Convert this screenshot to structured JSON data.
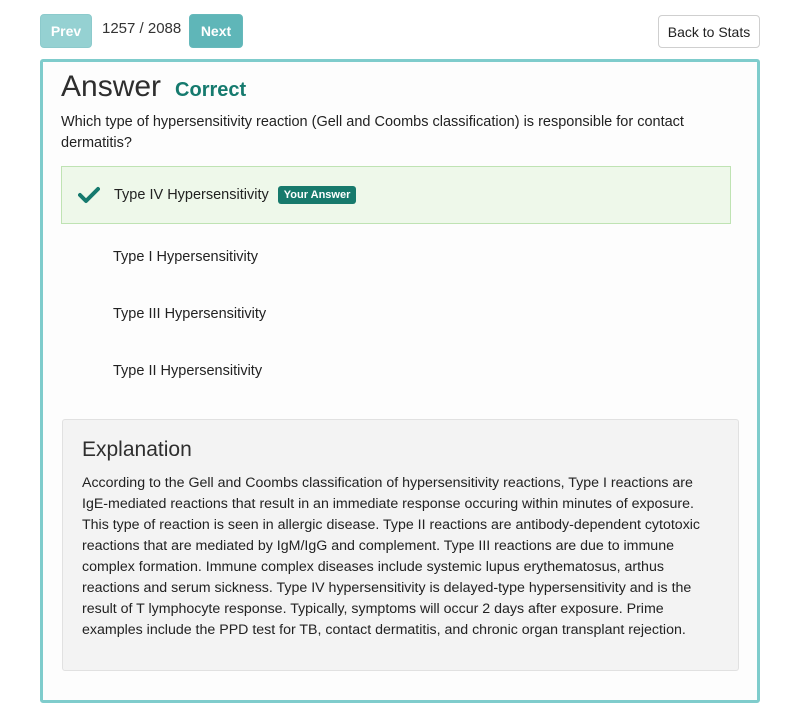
{
  "nav": {
    "prev_label": "Prev",
    "counter": "1257 / 2088",
    "next_label": "Next",
    "back_label": "Back to Stats"
  },
  "answer": {
    "title": "Answer",
    "result": "Correct",
    "question": "Which type of hypersensitivity reaction (Gell and Coombs classification) is responsible for contact dermatitis?",
    "options": [
      {
        "label": "Type IV Hypersensitivity",
        "selected": true,
        "badge": "Your Answer"
      },
      {
        "label": "Type I Hypersensitivity",
        "selected": false
      },
      {
        "label": "Type III Hypersensitivity",
        "selected": false
      },
      {
        "label": "Type II Hypersensitivity",
        "selected": false
      }
    ]
  },
  "explanation": {
    "title": "Explanation",
    "body": "According to the Gell and Coombs classification of hypersensitivity reactions, Type I reactions are IgE-mediated reactions that result in an immediate response occuring within minutes of exposure. This type of reaction is seen in allergic disease. Type II reactions are antibody-dependent cytotoxic reactions that are mediated by IgM/IgG and complement. Type III reactions are due to immune complex formation. Immune complex diseases include systemic lupus erythematosus, arthus reactions and serum sickness. Type IV hypersensitivity is delayed-type hypersensitivity and is the result of T lymphocyte response. Typically, symptoms will occur 2 days after exposure. Prime examples include the PPD test for TB, contact dermatitis, and chronic organ transplant rejection."
  },
  "icons": {
    "correct_mark": "checkmark-icon"
  },
  "colors": {
    "accent": "#72c2c4",
    "correct": "#157a6e",
    "card_border": "#7fcccc"
  }
}
